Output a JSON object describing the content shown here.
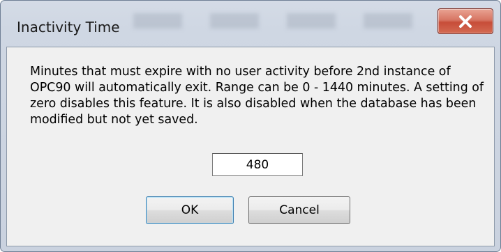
{
  "window": {
    "title": "Inactivity Time"
  },
  "dialog": {
    "message": "Minutes that must expire with no user activity before 2nd instance of OPC90 will automatically exit. Range can be 0 - 1440 minutes. A setting of zero disables this feature. It is also disabled when the database has been modified but not yet saved.",
    "minutes_value": "480",
    "ok_label": "OK",
    "cancel_label": "Cancel"
  },
  "icons": {
    "close": "close-icon"
  },
  "colors": {
    "close_button": "#c74d39",
    "client_background": "#f0f0f0",
    "frame": "#cfd7e3"
  }
}
